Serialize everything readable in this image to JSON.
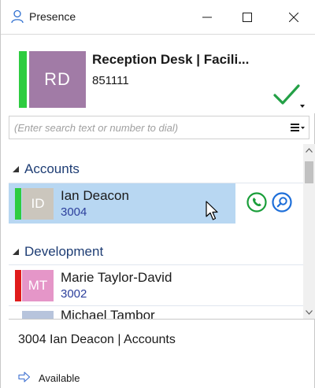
{
  "window": {
    "title": "Presence"
  },
  "user": {
    "initials": "RD",
    "name": "Reception Desk | Facili...",
    "extension": "851111",
    "status_color": "#2ecc40",
    "avatar_color": "#a17ba6",
    "status_icon": "checkmark-icon"
  },
  "search": {
    "placeholder": "(Enter search text or number to dial)",
    "value": ""
  },
  "groups": [
    {
      "label": "Accounts",
      "contacts": [
        {
          "initials": "ID",
          "name": "Ian Deacon",
          "extension": "3004",
          "status_color": "#2ecc40",
          "avatar_color": "#cbc6bd",
          "selected": true
        }
      ]
    },
    {
      "label": "Development",
      "contacts": [
        {
          "initials": "MT",
          "name": "Marie Taylor-David",
          "extension": "3002",
          "status_color": "#e01b1b",
          "avatar_color": "#e596c8",
          "selected": false
        },
        {
          "initials": "",
          "name": "Michael Tambor",
          "extension": "",
          "status_color": "",
          "avatar_color": "#b7c4dc",
          "selected": false
        }
      ]
    }
  ],
  "details": {
    "text": "3004  Ian Deacon  |  Accounts"
  },
  "footer": {
    "status_label": "Available"
  },
  "colors": {
    "accent": "#1e3d74",
    "selection": "#b8d7f2",
    "call_green": "#1a9e3a",
    "search_blue": "#1e6fd9"
  }
}
